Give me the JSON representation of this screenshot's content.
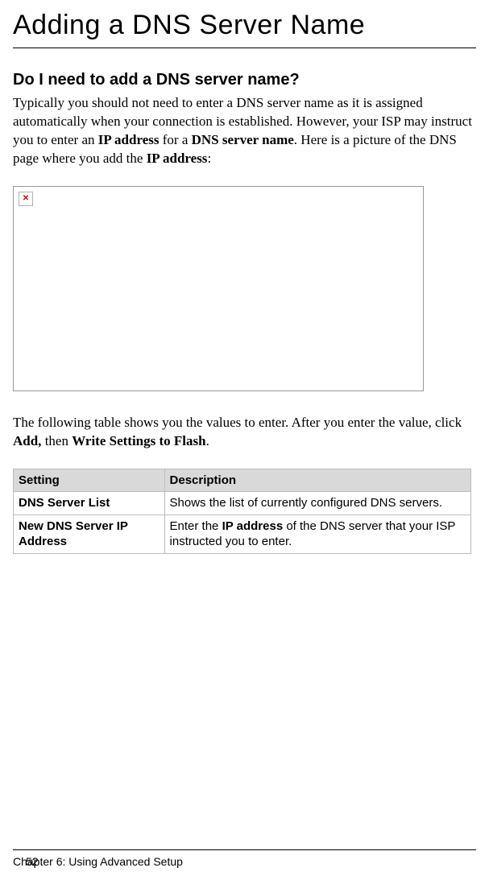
{
  "title": "Adding a DNS Server Name",
  "section_heading": "Do I need to add a DNS server name?",
  "para1_pre": "Typically you should not need to enter a DNS server name as it is assigned automatically when your connection is established. However, your ISP may instruct you to enter an ",
  "para1_bold1": "IP address",
  "para1_mid": " for a ",
  "para1_bold2": "DNS server name",
  "para1_post": ". Here is a picture of the DNS page where you add the ",
  "para1_bold3": "IP address",
  "para1_end": ":",
  "para2_pre": "The following table shows you the values to enter. After you enter the value, click ",
  "para2_bold1": "Add,",
  "para2_mid": " then ",
  "para2_bold2": "Write Settings to Flash",
  "para2_end": ".",
  "table": {
    "header_setting": "Setting",
    "header_description": "Description",
    "rows": [
      {
        "setting": "DNS Server List",
        "desc_pre": "Shows the list of currently configured DNS servers.",
        "desc_bold": "",
        "desc_post": ""
      },
      {
        "setting": "New DNS Server IP Address",
        "desc_pre": "Enter the ",
        "desc_bold": "IP address",
        "desc_post": " of the DNS server that your ISP instructed you to enter."
      }
    ]
  },
  "footer_text": "Chapter 6: Using Advanced Setup",
  "page_number": "52"
}
